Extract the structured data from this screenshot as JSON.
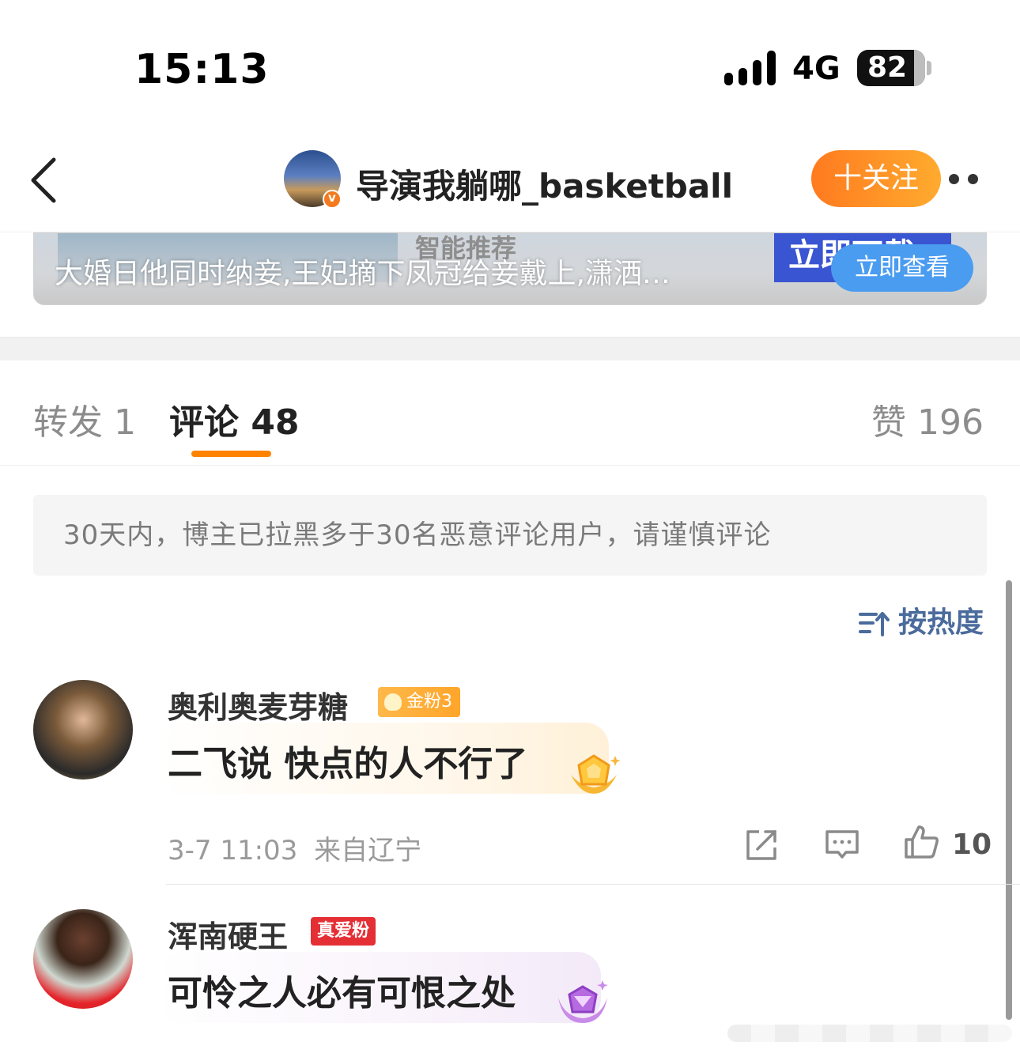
{
  "status_bar": {
    "time": "15:13",
    "network": "4G",
    "battery": "82"
  },
  "header": {
    "title": "导演我躺哪_basketball",
    "follow_label": "十关注",
    "back_icon": "chevron-left-icon",
    "more_icon": "more-dots-icon"
  },
  "ad": {
    "label": "智能推荐",
    "download_label": "立即下载",
    "text": "大婚日他同时纳妾,王妃摘下凤冠给妾戴上,潇洒…",
    "button": "立即查看"
  },
  "tabs": {
    "repost": "转发 1",
    "comments": "评论 48",
    "likes": "赞 196",
    "active_color": "#ff8200"
  },
  "notice": "30天内，博主已拉黑多于30名恶意评论用户，请谨慎评论",
  "sort": {
    "label": "按热度",
    "icon": "sort-icon"
  },
  "comments": [
    {
      "name": "奥利奥麦芽糖",
      "badge": "金粉3",
      "text": "二飞说 快点的人不行了",
      "time": "3-7 11:03",
      "location": "来自辽宁",
      "likes": "10"
    },
    {
      "name": "浑南硬王",
      "badge": "真爱粉",
      "text": "可怜之人必有可恨之处"
    }
  ],
  "colors": {
    "accent": "#ff8200",
    "follow": "#ff9a26",
    "link_blue": "#4a6b9c",
    "badge_red": "#e42f35"
  }
}
